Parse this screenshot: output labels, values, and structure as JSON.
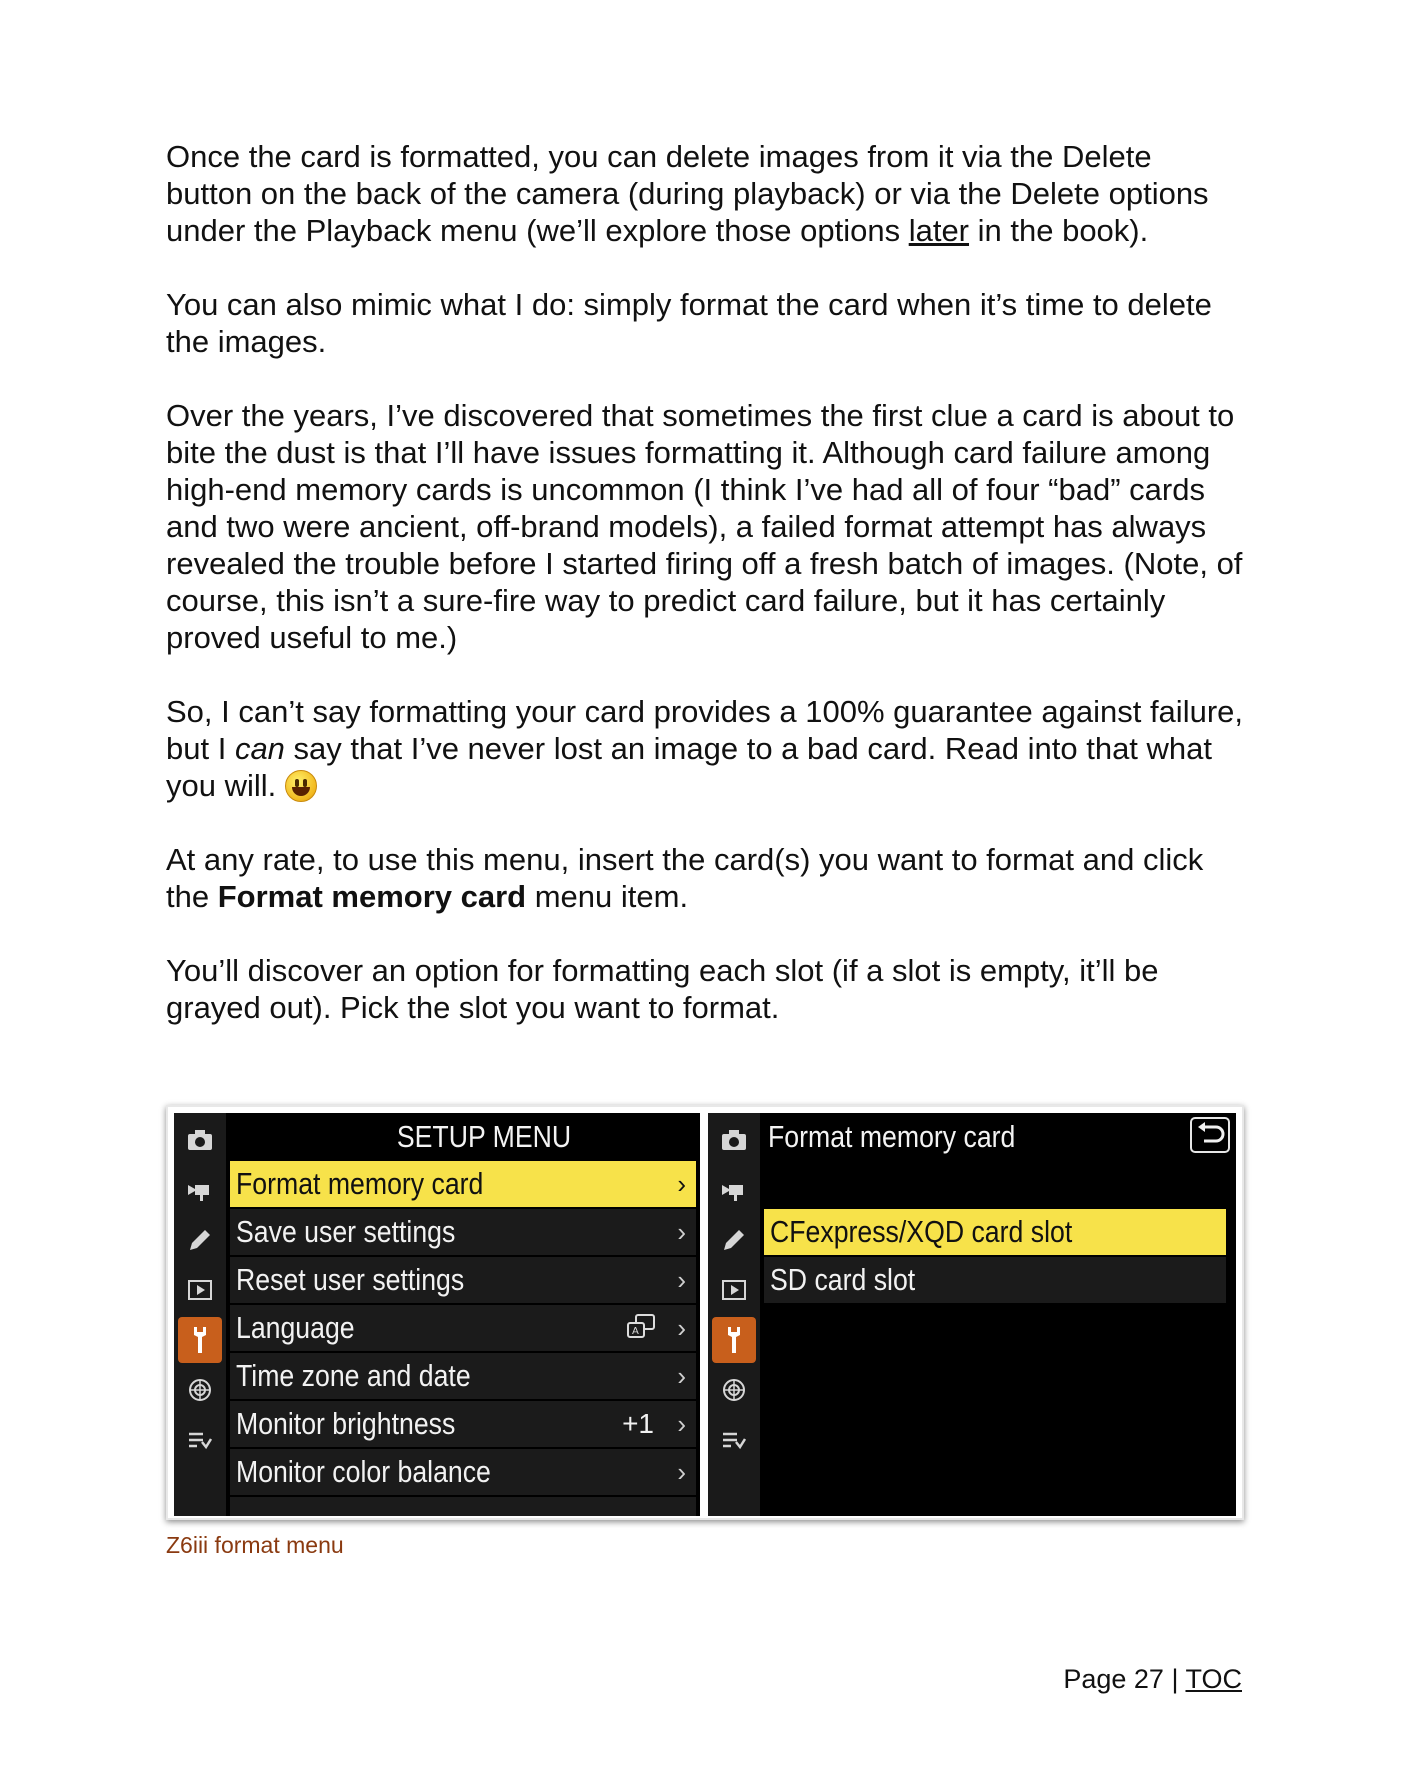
{
  "paragraphs": {
    "p1_a": "Once the card is formatted, you can delete images from it via the Delete button on the back of the camera (during playback) or via the Delete options under the Playback menu (we’ll explore those options ",
    "p1_link": "later",
    "p1_b": " in the book).",
    "p2": "You can also mimic what I do: simply format the card when it’s time to delete the images.",
    "p3": "Over the years, I’ve discovered that sometimes the first clue a card is about to bite the dust is that I’ll have issues formatting it. Although card failure among high-end memory cards is uncommon (I think I’ve had all of four “bad” cards and two were ancient, off-brand models), a failed format attempt has always revealed the trouble before I started firing off a fresh batch of images. (Note, of course, this isn’t a sure-fire way to predict card failure, but it has certainly proved useful to me.)",
    "p4_a": "So, I can’t say formatting your card provides a 100% guarantee against failure, but I ",
    "p4_em": "can",
    "p4_b": " say that I’ve never lost an image to a bad card. Read into that what you will. ",
    "p5_a": "At any rate, to use this menu, insert the card(s) you want to format and click the ",
    "p5_bold": "Format memory card",
    "p5_b": " menu item.",
    "p6": "You’ll discover an option for formatting each slot (if a slot is empty, it’ll be grayed out). Pick the slot you want to format."
  },
  "left_screen": {
    "title": "SETUP MENU",
    "items": [
      {
        "label": "Format memory card",
        "value": "",
        "selected": true
      },
      {
        "label": "Save user settings",
        "value": ""
      },
      {
        "label": "Reset user settings",
        "value": ""
      },
      {
        "label": "Language",
        "value": ""
      },
      {
        "label": "Time zone and date",
        "value": ""
      },
      {
        "label": "Monitor brightness",
        "value": "+1"
      },
      {
        "label": "Monitor color balance",
        "value": ""
      }
    ],
    "chevron": "›"
  },
  "right_screen": {
    "title": "Format memory card",
    "items": [
      {
        "label": "CFexpress/XQD card slot",
        "selected": true
      },
      {
        "label": "SD card slot"
      }
    ]
  },
  "rail_icons": [
    "camera-icon",
    "movie-icon",
    "pencil-icon",
    "playback-icon",
    "wrench-icon",
    "network-icon",
    "my-menu-icon"
  ],
  "colors": {
    "highlight": "#f7e24a",
    "active_tab": "#c85f1c",
    "caption": "#8a3a10"
  },
  "caption": "Z6iii format menu",
  "footer": {
    "page_label": "Page 27 | ",
    "toc": "TOC"
  }
}
